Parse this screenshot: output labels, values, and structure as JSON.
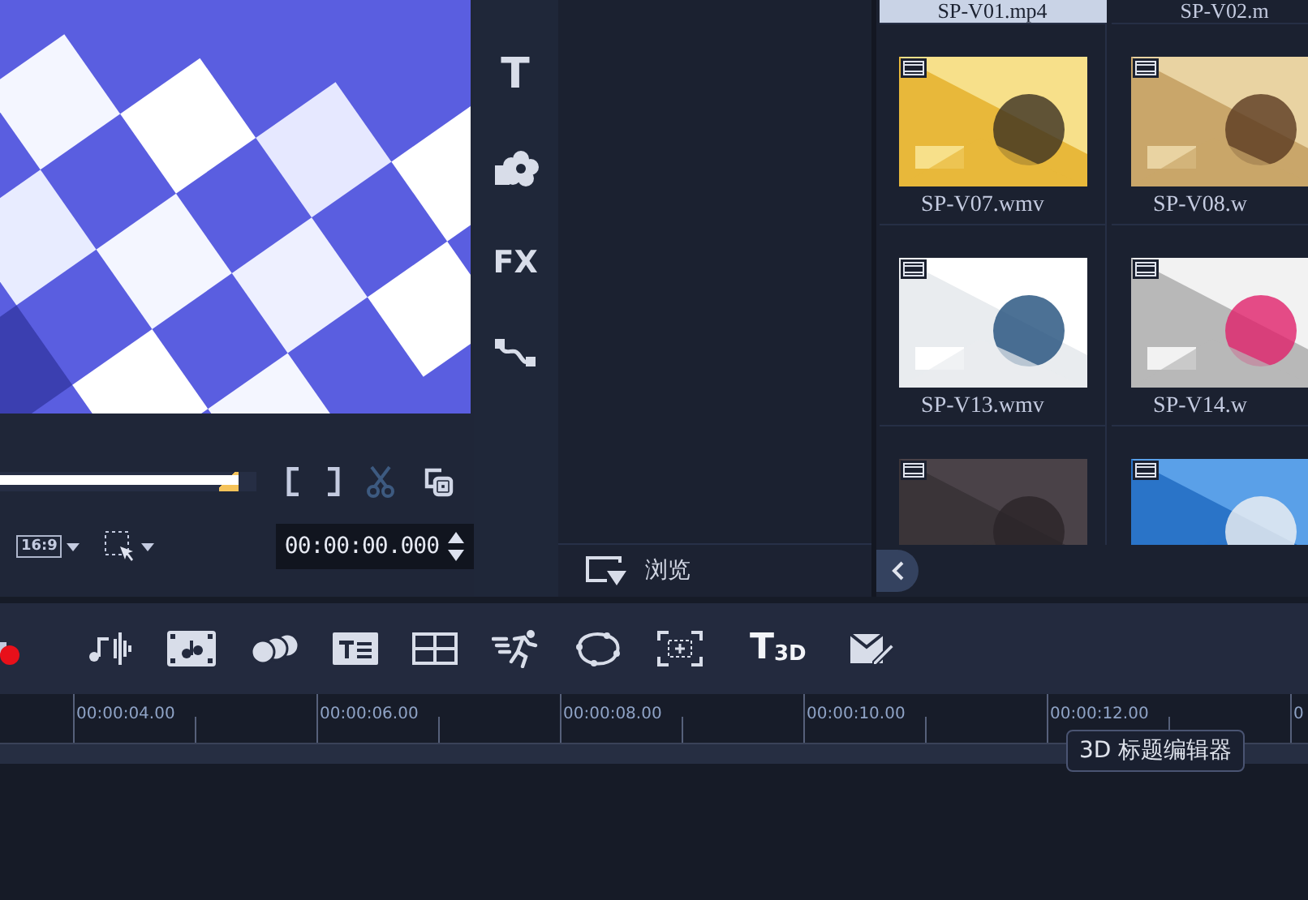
{
  "preview": {
    "scrubber": {
      "level": 0.93
    },
    "aspect": "16:9",
    "timecode": "00:00:00.000"
  },
  "library": {
    "sidebar": [
      {
        "kind": "text",
        "label": "T"
      },
      {
        "kind": "icon"
      },
      {
        "kind": "text",
        "label": "FX"
      },
      {
        "kind": "icon"
      }
    ],
    "browse": "浏览",
    "header_labels": [
      {
        "label": "SP-V01.mp4",
        "selected": true
      },
      {
        "label": "SP-V02.m",
        "selected": false
      }
    ],
    "clips": [
      {
        "kind": "video",
        "label": "SP-V07.wmv"
      },
      {
        "kind": "video",
        "label": "SP-V08.w"
      },
      {
        "kind": "video",
        "label": "SP-V13.wmv"
      },
      {
        "kind": "video",
        "label": "SP-V14.w"
      },
      {
        "kind": "video"
      },
      {
        "kind": "video"
      }
    ]
  },
  "toolbar": [
    {
      "kind": "record"
    },
    {
      "kind": "audio"
    },
    {
      "kind": "score"
    },
    {
      "kind": "circles"
    },
    {
      "kind": "title"
    },
    {
      "kind": "grid"
    },
    {
      "kind": "motion"
    },
    {
      "kind": "path"
    },
    {
      "kind": "frame"
    },
    {
      "kind": "text",
      "big": "T",
      "small": "3D"
    },
    {
      "kind": "paint"
    }
  ],
  "ruler": [
    "00:00:04.00",
    "00:00:06.00",
    "00:00:08.00",
    "00:00:10.00",
    "00:00:12.00",
    "0"
  ],
  "tooltip": "3D 标题编辑器"
}
